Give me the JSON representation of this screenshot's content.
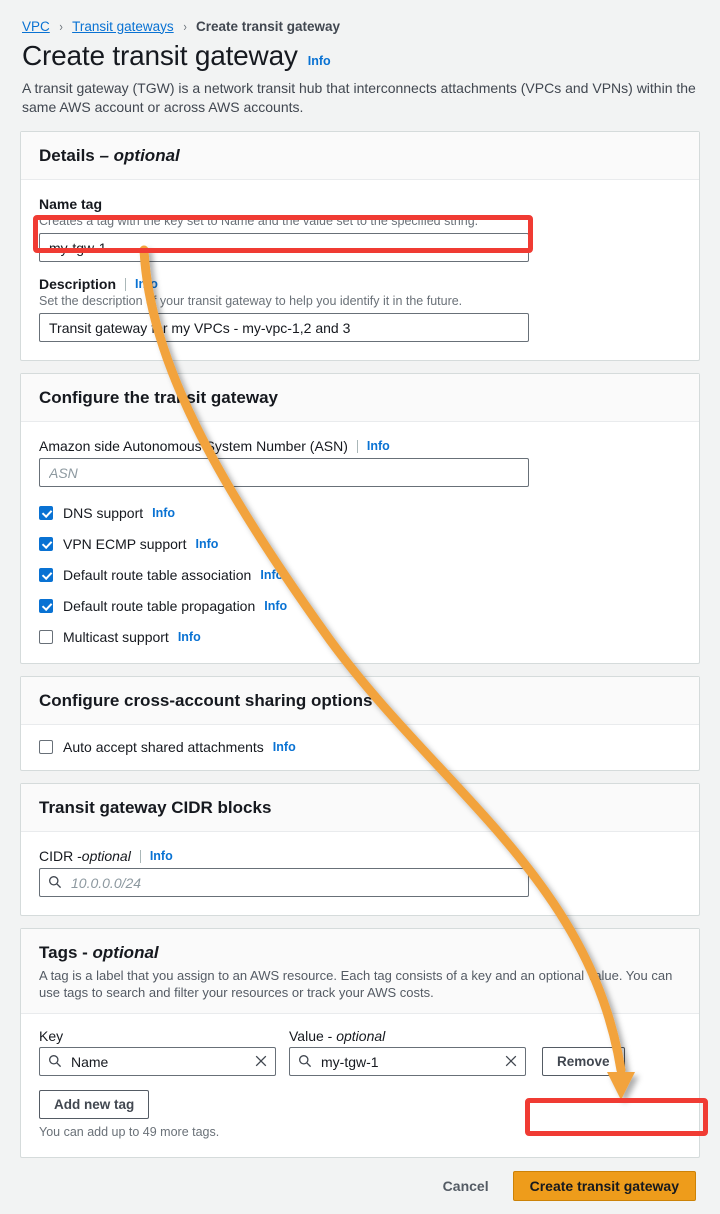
{
  "breadcrumb": {
    "items": [
      {
        "label": "VPC",
        "type": "link"
      },
      {
        "label": "Transit gateways",
        "type": "link"
      },
      {
        "label": "Create transit gateway",
        "type": "current"
      }
    ],
    "separator": "›"
  },
  "header": {
    "title": "Create transit gateway",
    "info_label": "Info",
    "description": "A transit gateway (TGW) is a network transit hub that interconnects attachments (VPCs and VPNs) within the same AWS account or across AWS accounts."
  },
  "details_panel": {
    "title": "Details",
    "title_optional": " – optional",
    "name_tag": {
      "label": "Name tag",
      "hint": "Creates a tag with the key set to Name and the value set to the specified string.",
      "value": "my-tgw-1",
      "placeholder": ""
    },
    "description_field": {
      "label": "Description",
      "info_label": "Info",
      "hint": "Set the description of your transit gateway to help you identify it in the future.",
      "value": "Transit gateway for my VPCs - my-vpc-1,2 and 3",
      "placeholder": ""
    }
  },
  "configure_panel": {
    "title": "Configure the transit gateway",
    "asn": {
      "label": "Amazon side Autonomous System Number (ASN)",
      "info_label": "Info",
      "value": "",
      "placeholder": "ASN"
    },
    "checkboxes": [
      {
        "label": "DNS support",
        "checked": true,
        "info_label": "Info"
      },
      {
        "label": "VPN ECMP support",
        "checked": true,
        "info_label": "Info"
      },
      {
        "label": "Default route table association",
        "checked": true,
        "info_label": "Info"
      },
      {
        "label": "Default route table propagation",
        "checked": true,
        "info_label": "Info"
      },
      {
        "label": "Multicast support",
        "checked": false,
        "info_label": "Info"
      }
    ]
  },
  "sharing_panel": {
    "title": "Configure cross-account sharing options",
    "checkbox": {
      "label": "Auto accept shared attachments",
      "checked": false,
      "info_label": "Info"
    }
  },
  "cidr_panel": {
    "title": "Transit gateway CIDR blocks",
    "cidr": {
      "label": "CIDR - ",
      "label_optional": "optional",
      "info_label": "Info",
      "value": "",
      "placeholder": "10.0.0.0/24"
    }
  },
  "tags_panel": {
    "title": "Tags - ",
    "title_optional": "optional",
    "description": "A tag is a label that you assign to an AWS resource. Each tag consists of a key and an optional value. You can use tags to search and filter your resources or track your AWS costs.",
    "column_key": "Key",
    "column_value": "Value - ",
    "column_value_optional": "optional",
    "rows": [
      {
        "key": "Name",
        "value": "my-tgw-1",
        "remove_label": "Remove"
      }
    ],
    "add_tag_label": "Add new tag",
    "note": "You can add up to 49 more tags."
  },
  "footer": {
    "cancel_label": "Cancel",
    "submit_label": "Create transit gateway"
  },
  "annotations": {
    "highlight_color": "#f03b33",
    "arrow_color": "#f2a33c",
    "arrow_from": "name-tag-input",
    "arrow_to": "create-transit-gateway-button"
  },
  "colors": {
    "link": "#0972d3",
    "checkbox_checked": "#0972d3",
    "primary_button": "#ee9c1b",
    "page_background": "#f2f3f3",
    "panel_background": "#ffffff"
  }
}
